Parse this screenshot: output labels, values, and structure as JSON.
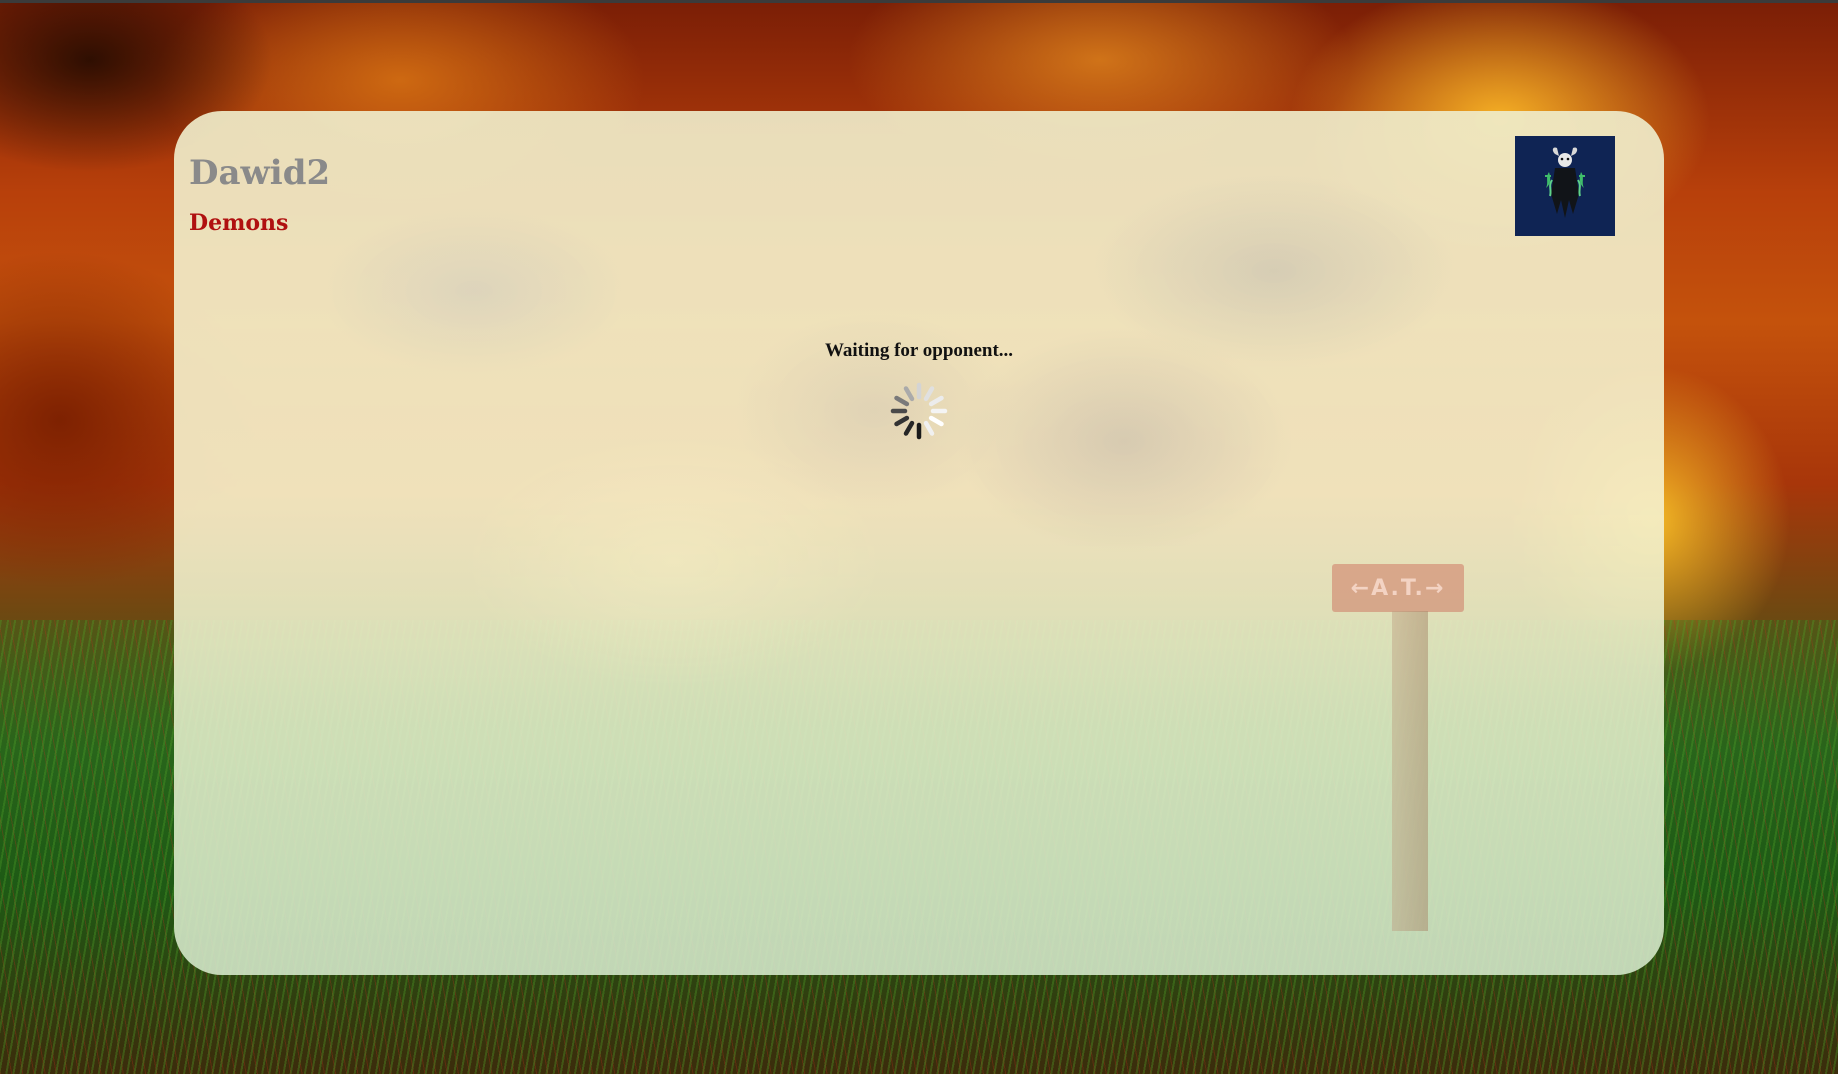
{
  "player": {
    "name": "Dawid2",
    "faction": "Demons"
  },
  "status": {
    "message": "Waiting for opponent..."
  },
  "avatar": {
    "icon": "horned-demon-icon",
    "background": "#0f2454"
  },
  "background": {
    "sign_text": "←A.T.→"
  },
  "colors": {
    "faction": "#b01010",
    "name": "#8a8a8a"
  }
}
